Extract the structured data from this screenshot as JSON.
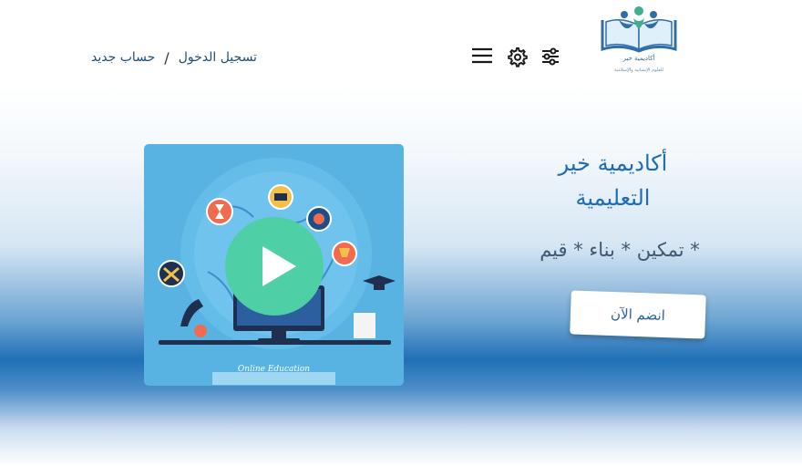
{
  "header": {
    "logo_text": "أكاديمية خير",
    "logo_tagline": "أكاديمية خير",
    "logo_subline": "للعلوم الإنسانية والإسلامية",
    "icons": [
      "filter-sliders-icon",
      "gear-icon",
      "hamburger-menu-icon"
    ],
    "auth": {
      "login": "تسجيل الدخول",
      "separator": "/",
      "register": "حساب جديد"
    }
  },
  "hero": {
    "title_line1": "أكاديمية خير",
    "title_line2": "التعليمية",
    "tagline": "* تمكين * بناء * قيم",
    "join_label": "انضم الآن",
    "video": {
      "caption": "Online Education",
      "play_icon": "play-icon"
    }
  },
  "colors": {
    "brand_blue": "#1f6bb5",
    "video_bg": "#59b3e2",
    "play_button": "#4fcfa6",
    "hero_band": "#1f6fb7"
  }
}
